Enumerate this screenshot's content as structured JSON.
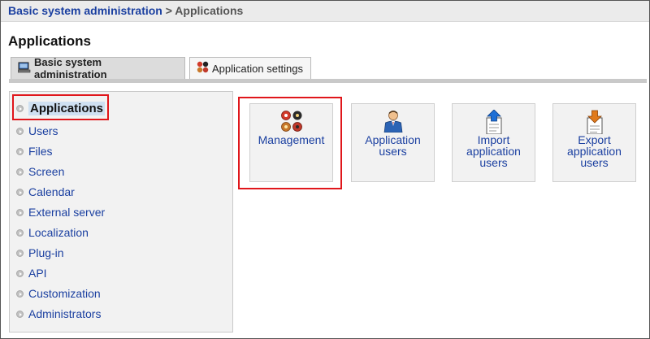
{
  "breadcrumb": {
    "parent": "Basic system administration",
    "separator": " > ",
    "current": "Applications"
  },
  "page_title": "Applications",
  "tabs": [
    {
      "label": "Basic system administration",
      "icon": "computer-icon",
      "active": true
    },
    {
      "label": "Application settings",
      "icon": "app-settings-icon",
      "active": false
    }
  ],
  "sidebar": {
    "items": [
      {
        "label": "Applications",
        "selected": true
      },
      {
        "label": "Users"
      },
      {
        "label": "Files"
      },
      {
        "label": "Screen"
      },
      {
        "label": "Calendar"
      },
      {
        "label": "External server"
      },
      {
        "label": "Localization"
      },
      {
        "label": "Plug-in"
      },
      {
        "label": "API"
      },
      {
        "label": "Customization"
      },
      {
        "label": "Administrators"
      }
    ]
  },
  "tiles": [
    {
      "label": "Management",
      "icon": "management-icon"
    },
    {
      "label": "Application\nusers",
      "icon": "user-icon"
    },
    {
      "label": "Import\napplication\nusers",
      "icon": "import-icon"
    },
    {
      "label": "Export\napplication\nusers",
      "icon": "export-icon"
    }
  ],
  "colors": {
    "link": "#1a3fa0",
    "highlight": "#e0161b",
    "panel": "#f2f2f2"
  }
}
